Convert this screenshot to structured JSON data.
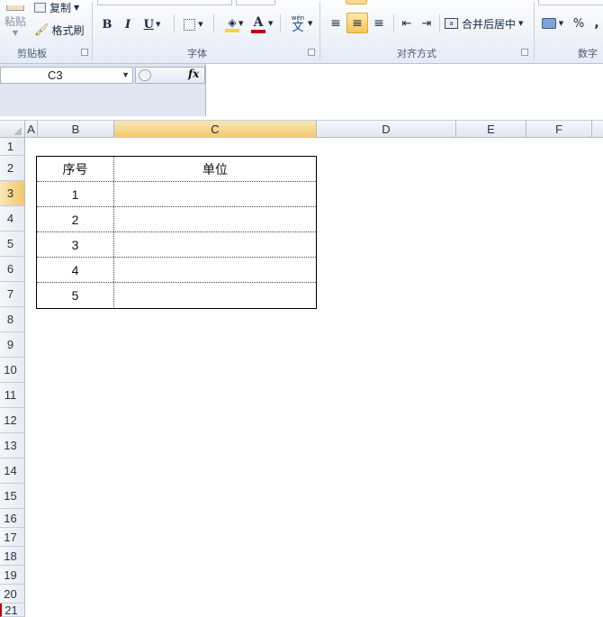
{
  "ribbon": {
    "clipboard": {
      "paste_label": "粘贴",
      "copy_label": "复制",
      "format_painter_label": "格式刷",
      "group_label": "剪贴板"
    },
    "font": {
      "bold": "B",
      "italic": "I",
      "underline": "U",
      "font_color": "A",
      "phonetic": "wén",
      "phonetic_char": "文",
      "group_label": "字体"
    },
    "alignment": {
      "merge_center_label": "合并后居中",
      "group_label": "对齐方式"
    },
    "number": {
      "percent": "%",
      "comma": ",",
      "group_label": "数字"
    }
  },
  "formula_bar": {
    "name_box": "C3",
    "fx_label": "fx",
    "formula": ""
  },
  "sheet": {
    "columns": [
      "A",
      "B",
      "C",
      "D",
      "E",
      "F"
    ],
    "active_column": "C",
    "rows": [
      "1",
      "2",
      "3",
      "4",
      "5",
      "6",
      "7",
      "8",
      "9",
      "10",
      "11",
      "12",
      "13",
      "14",
      "15",
      "16",
      "17",
      "18",
      "19",
      "20",
      "21"
    ],
    "active_row": "3",
    "table": {
      "headers": [
        "序号",
        "单位"
      ],
      "rows": [
        [
          "1",
          ""
        ],
        [
          "2",
          ""
        ],
        [
          "3",
          ""
        ],
        [
          "4",
          ""
        ],
        [
          "5",
          ""
        ]
      ]
    }
  },
  "colors": {
    "highlight_fill": "#f7d247",
    "font_color_bar": "#c00000",
    "selection": "#f2c96a"
  }
}
